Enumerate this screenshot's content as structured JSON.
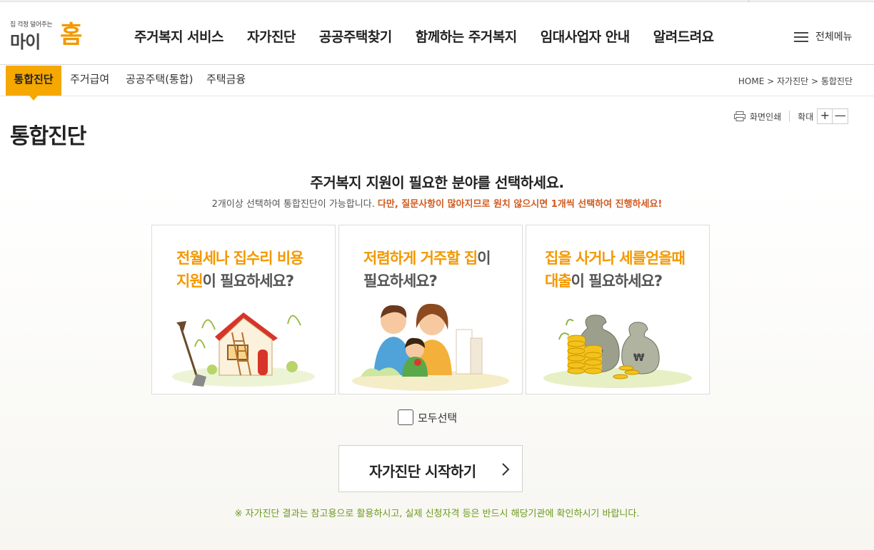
{
  "logo": {
    "tagline": "집 걱정 덜어주는",
    "name_part1": "마이",
    "name_part2": "홈"
  },
  "gnb": [
    {
      "label": "주거복지 서비스"
    },
    {
      "label": "자가진단"
    },
    {
      "label": "공공주택찾기"
    },
    {
      "label": "함께하는 주거복지"
    },
    {
      "label": "임대사업자 안내"
    },
    {
      "label": "알려드려요"
    }
  ],
  "all_menu_label": "전체메뉴",
  "subnav": [
    {
      "label": "통합진단",
      "active": true
    },
    {
      "label": "주거급여"
    },
    {
      "label": "공공주택(통합)"
    },
    {
      "label": "주택금융"
    }
  ],
  "breadcrumb": "HOME > 자가진단 > 통합진단",
  "page_title": "통합진단",
  "tools": {
    "print_label": "화면인쇄",
    "zoom_label": "확대",
    "zoom_in": "+",
    "zoom_out": "—"
  },
  "main": {
    "heading": "주거복지 지원이 필요한 분야를 선택하세요.",
    "desc_normal": "2개이상 선택하여 통합진단이 가능합니다. ",
    "desc_warn": "다만, 질문사항이 많아지므로 원치 않으시면 1개씩 선택하여 진행하세요!"
  },
  "cards": [
    {
      "line1_hl": "전월세나 집수리 비용",
      "line2_hl": "지원",
      "line2_rest": "이 필요하세요?",
      "icon": "house-illustration"
    },
    {
      "line1_hl": "저렴하게 거주할 집",
      "line1_rest": "이",
      "line2_rest": "필요하세요?",
      "icon": "family-illustration"
    },
    {
      "line1_hl": "집을 사거나 세를얻을때",
      "line2_hl": "대출",
      "line2_rest": "이 필요하세요?",
      "icon": "money-bags-illustration"
    }
  ],
  "select_all_label": "모두선택",
  "start_button_label": "자가진단 시작하기",
  "notice": "※ 자가진단 결과는 참고용으로 활용하시고, 실제 신청자격 등은 반드시 해당기관에 확인하시기 바랍니다.",
  "colors": {
    "accent": "#f39800",
    "tab_active": "#f5a800",
    "warn": "#d25a1f",
    "notice": "#6c9a1e"
  }
}
